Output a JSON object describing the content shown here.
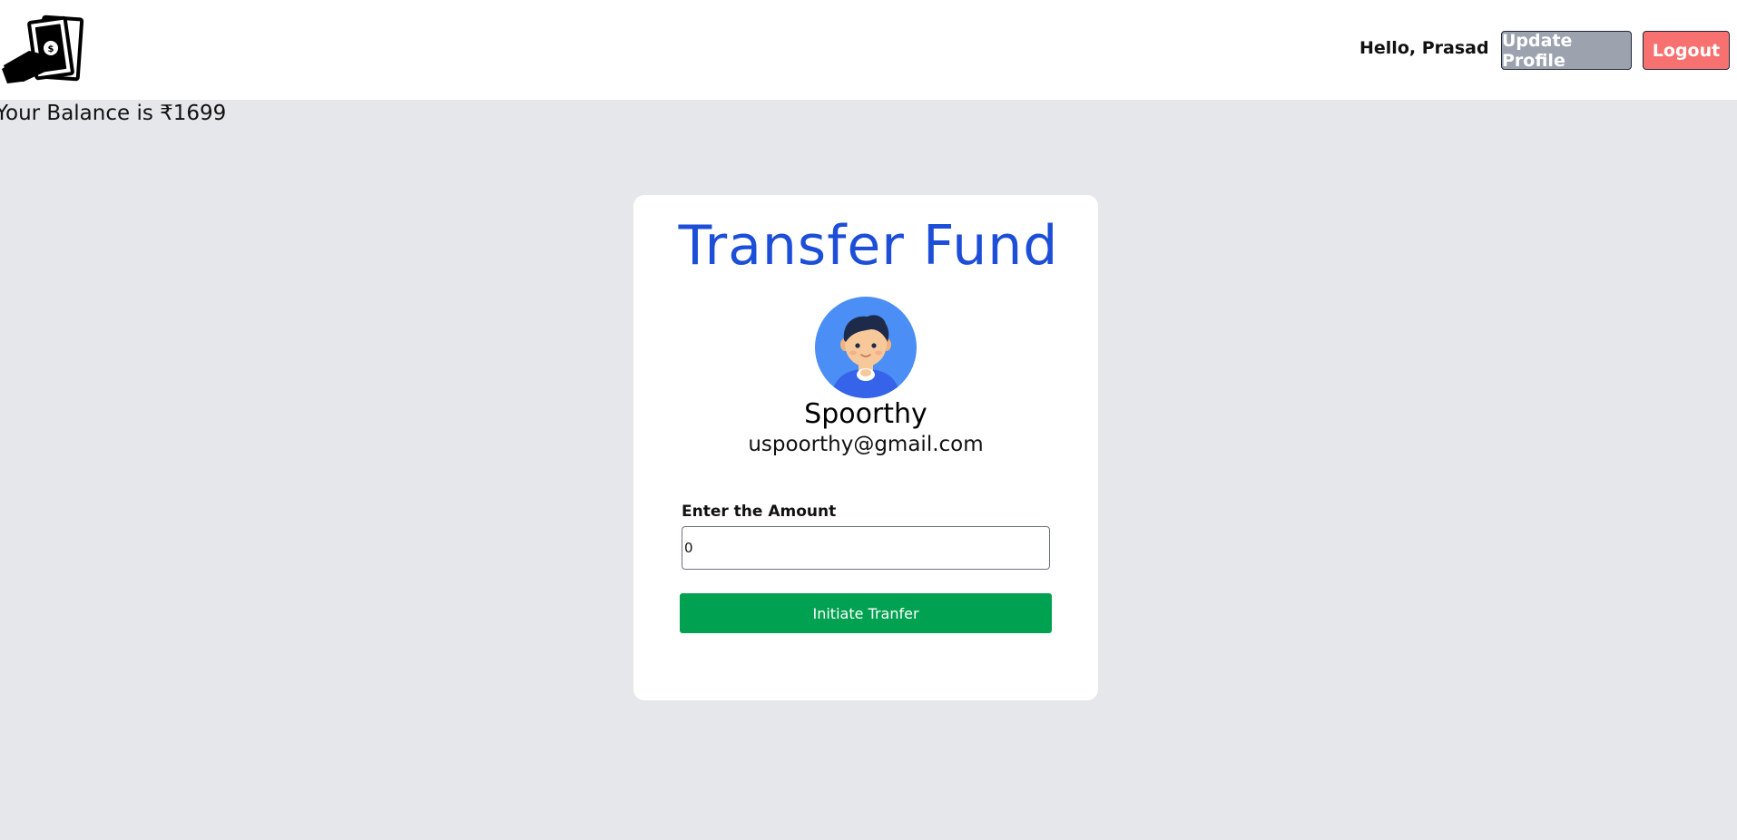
{
  "header": {
    "logo_icon": "hand-holding-money-icon",
    "greeting": "Hello, Prasad",
    "update_profile_label": "Update Profile",
    "logout_label": "Logout",
    "colors": {
      "update_bg": "#9ca3af",
      "logout_bg": "#f87171"
    }
  },
  "balance_text": "Your Balance is ₹1699",
  "transfer": {
    "title": "Transfer Fund",
    "avatar_icon": "user-avatar-icon",
    "recipient_name": "Spoorthy",
    "recipient_email": "uspoorthy@gmail.com",
    "amount_label": "Enter the Amount",
    "amount_value": "0",
    "submit_label": "Initiate Tranfer",
    "colors": {
      "title": "#1d4ed8",
      "submit_bg": "#00a150",
      "avatar_bg": "#4b8ef5"
    }
  }
}
